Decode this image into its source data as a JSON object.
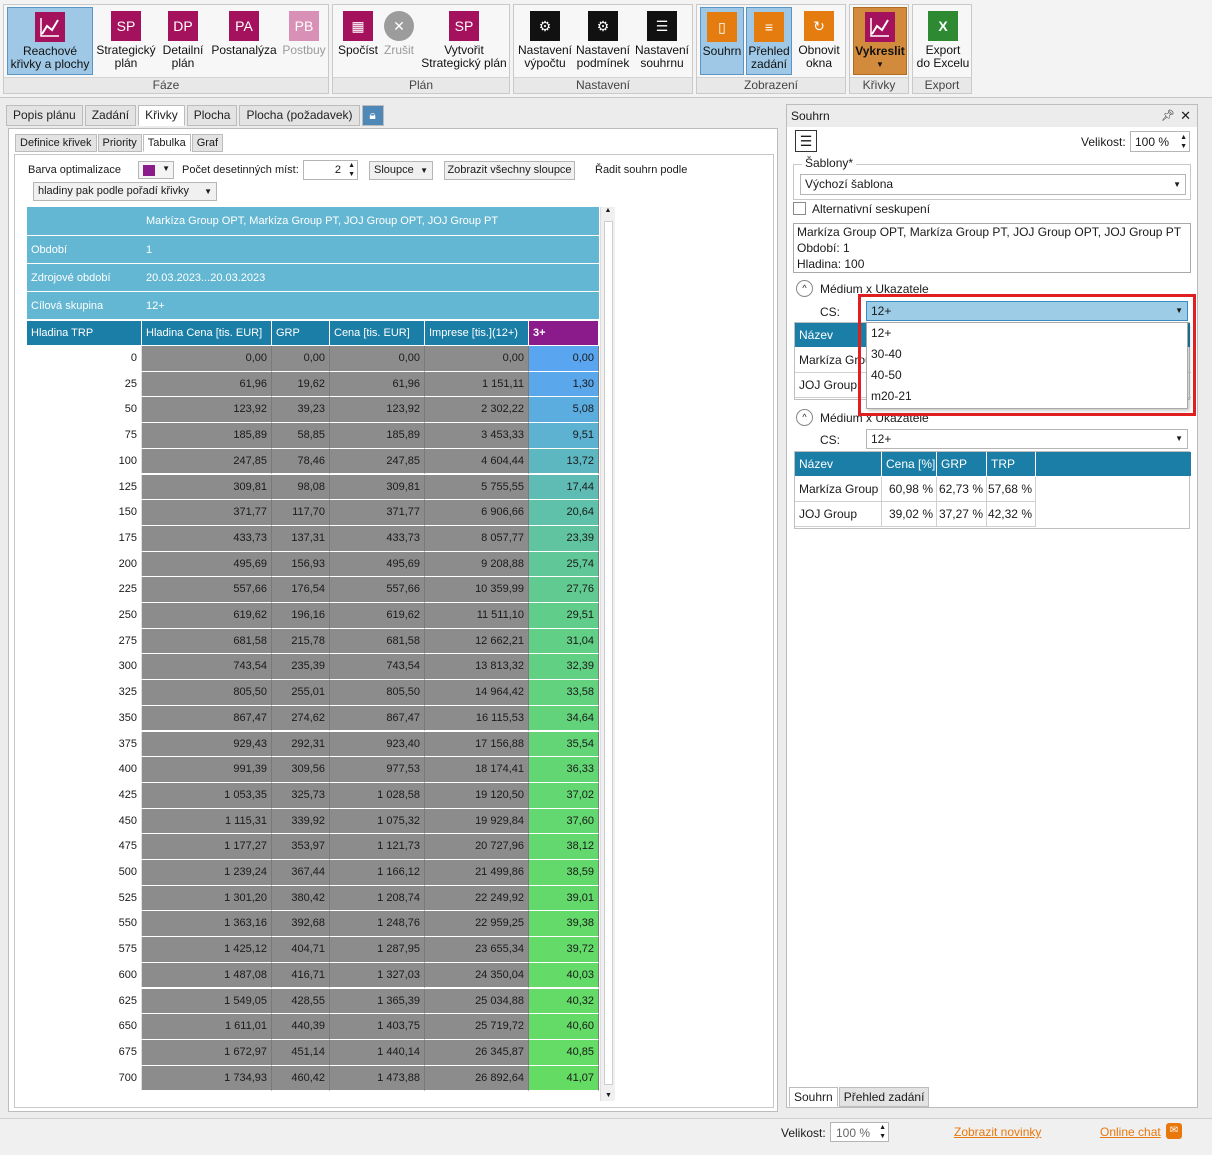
{
  "ribbon": {
    "groups": {
      "faze": "Fáze",
      "plan": "Plán",
      "nastaveni": "Nastavení",
      "zobrazeni": "Zobrazení",
      "krivky": "Křivky",
      "export": "Export"
    },
    "buttons": {
      "reach_l1": "Reachové",
      "reach_l2": "křivky a plochy",
      "sp_icon": "SP",
      "sp_l1": "Strategický",
      "sp_l2": "plán",
      "dp_icon": "DP",
      "dp_l1": "Detailní",
      "dp_l2": "plán",
      "pa_icon": "PA",
      "pa_l1": "Postanalýza",
      "pb_icon": "PB",
      "pb_l1": "Postbuy",
      "spocist": "Spočíst",
      "zrusit": "Zrušit",
      "vsp_icon": "SP",
      "vsp_l1": "Vytvořit",
      "vsp_l2": "Strategický plán",
      "nv_l1": "Nastavení",
      "nv_l2": "výpočtu",
      "np_l1": "Nastavení",
      "np_l2": "podmínek",
      "ns_l1": "Nastavení",
      "ns_l2": "souhrnu",
      "souhrn": "Souhrn",
      "prehled_l1": "Přehled",
      "prehled_l2": "zadání",
      "obnovit_l1": "Obnovit",
      "obnovit_l2": "okna",
      "vykreslit": "Vykreslit",
      "export_l1": "Export",
      "export_l2": "do Excelu"
    }
  },
  "main_tabs": [
    "Popis plánu",
    "Zadání",
    "Křivky",
    "Plocha",
    "Plocha (požadavek)"
  ],
  "sub_tabs": [
    "Definice křivek",
    "Priority",
    "Tabulka",
    "Graf"
  ],
  "toolbar": {
    "barva_label": "Barva optimalizace",
    "barva_color": "#8b1a8b",
    "desetin_label": "Počet desetinných míst:",
    "desetin_value": "2",
    "sloupce": "Sloupce",
    "zobrazit": "Zobrazit všechny sloupce",
    "radit_label": "Řadit souhrn podle",
    "radit_value": "hladiny pak podle pořadí křivky"
  },
  "grid": {
    "info": [
      {
        "key": "",
        "value": "Markíza Group OPT, Markíza Group PT, JOJ Group OPT, JOJ Group PT"
      },
      {
        "key": "Období",
        "value": "1"
      },
      {
        "key": "Zdrojové období",
        "value": "20.03.2023...20.03.2023"
      },
      {
        "key": "Cílová skupina",
        "value": "12+"
      }
    ],
    "columns": [
      "Hladina TRP",
      "Hladina Cena [tis. EUR]",
      "GRP",
      "Cena [tis. EUR]",
      "Imprese [tis.](12+)",
      "3+"
    ],
    "rows": [
      [
        "0",
        "0,00",
        "0,00",
        "0,00",
        "0,00",
        "0,00"
      ],
      [
        "25",
        "61,96",
        "19,62",
        "61,96",
        "1 151,11",
        "1,30"
      ],
      [
        "50",
        "123,92",
        "39,23",
        "123,92",
        "2 302,22",
        "5,08"
      ],
      [
        "75",
        "185,89",
        "58,85",
        "185,89",
        "3 453,33",
        "9,51"
      ],
      [
        "100",
        "247,85",
        "78,46",
        "247,85",
        "4 604,44",
        "13,72"
      ],
      [
        "125",
        "309,81",
        "98,08",
        "309,81",
        "5 755,55",
        "17,44"
      ],
      [
        "150",
        "371,77",
        "117,70",
        "371,77",
        "6 906,66",
        "20,64"
      ],
      [
        "175",
        "433,73",
        "137,31",
        "433,73",
        "8 057,77",
        "23,39"
      ],
      [
        "200",
        "495,69",
        "156,93",
        "495,69",
        "9 208,88",
        "25,74"
      ],
      [
        "225",
        "557,66",
        "176,54",
        "557,66",
        "10 359,99",
        "27,76"
      ],
      [
        "250",
        "619,62",
        "196,16",
        "619,62",
        "11 511,10",
        "29,51"
      ],
      [
        "275",
        "681,58",
        "215,78",
        "681,58",
        "12 662,21",
        "31,04"
      ],
      [
        "300",
        "743,54",
        "235,39",
        "743,54",
        "13 813,32",
        "32,39"
      ],
      [
        "325",
        "805,50",
        "255,01",
        "805,50",
        "14 964,42",
        "33,58"
      ],
      [
        "350",
        "867,47",
        "274,62",
        "867,47",
        "16 115,53",
        "34,64"
      ],
      [
        "375",
        "929,43",
        "292,31",
        "923,40",
        "17 156,88",
        "35,54"
      ],
      [
        "400",
        "991,39",
        "309,56",
        "977,53",
        "18 174,41",
        "36,33"
      ],
      [
        "425",
        "1 053,35",
        "325,73",
        "1 028,58",
        "19 120,50",
        "37,02"
      ],
      [
        "450",
        "1 115,31",
        "339,92",
        "1 075,32",
        "19 929,84",
        "37,60"
      ],
      [
        "475",
        "1 177,27",
        "353,97",
        "1 121,73",
        "20 727,96",
        "38,12"
      ],
      [
        "500",
        "1 239,24",
        "367,44",
        "1 166,12",
        "21 499,86",
        "38,59"
      ],
      [
        "525",
        "1 301,20",
        "380,42",
        "1 208,74",
        "22 249,92",
        "39,01"
      ],
      [
        "550",
        "1 363,16",
        "392,68",
        "1 248,76",
        "22 959,25",
        "39,38"
      ],
      [
        "575",
        "1 425,12",
        "404,71",
        "1 287,95",
        "23 655,34",
        "39,72"
      ],
      [
        "600",
        "1 487,08",
        "416,71",
        "1 327,03",
        "24 350,04",
        "40,03"
      ],
      [
        "625",
        "1 549,05",
        "428,55",
        "1 365,39",
        "25 034,88",
        "40,32"
      ],
      [
        "650",
        "1 611,01",
        "440,39",
        "1 403,75",
        "25 719,72",
        "40,60"
      ],
      [
        "675",
        "1 672,97",
        "451,14",
        "1 440,14",
        "26 345,87",
        "40,85"
      ],
      [
        "700",
        "1 734,93",
        "460,42",
        "1 473,88",
        "26 892,64",
        "41,07"
      ]
    ]
  },
  "summary": {
    "title": "Souhrn",
    "velikost_label": "Velikost:",
    "velikost_value": "100 %",
    "sablony_label": "Šablony*",
    "sablona_value": "Výchozí šablona",
    "alt_label": "Alternativní seskupení",
    "info_l1": "Markíza Group OPT, Markíza Group PT, JOJ Group OPT, JOJ Group PT",
    "info_l2": "Období: 1",
    "info_l3": "Hladina: 100",
    "section1": "Médium x Ukazatele",
    "section2": "Médium x Ukazatele",
    "cs_label": "CS:",
    "cs_value1": "12+",
    "cs_value2": "12+",
    "dropdown_options": [
      "12+",
      "30-40",
      "40-50",
      "m20-21"
    ],
    "table1_col": "Název",
    "table1_rows": [
      "Markíza Grou",
      "JOJ Group"
    ],
    "table2_cols": [
      "Název",
      "Cena [%]",
      "GRP [%]",
      "TRP [%]"
    ],
    "table2_rows": [
      [
        "Markíza Group",
        "60,98 %",
        "62,73 %",
        "57,68 %"
      ],
      [
        "JOJ Group",
        "39,02 %",
        "37,27 %",
        "42,32 %"
      ]
    ],
    "bottom_tabs": [
      "Souhrn",
      "Přehled zadání"
    ]
  },
  "status": {
    "velikost_label": "Velikost:",
    "velikost_value": "100 %",
    "novinky": "Zobrazit novinky",
    "chat": "Online chat"
  },
  "colors": {
    "header_blue": "#63b7d3",
    "column_blue": "#1b7ea7",
    "magenta": "#a4125e",
    "purple": "#8b1a8b",
    "gray_col": "#8c8c8c",
    "highlight_red": "#e02020"
  }
}
